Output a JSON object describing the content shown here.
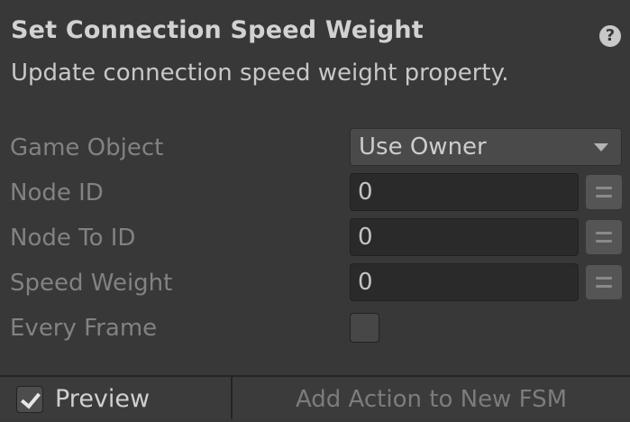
{
  "header": {
    "title": "Set Connection Speed Weight",
    "help_icon": "question-mark-icon",
    "help_glyph": "?",
    "description": "Update connection speed weight property."
  },
  "fields": {
    "game_object": {
      "label": "Game Object",
      "value": "Use Owner"
    },
    "node_id": {
      "label": "Node ID",
      "value": "0"
    },
    "node_to_id": {
      "label": "Node To ID",
      "value": "0"
    },
    "speed_weight": {
      "label": "Speed Weight",
      "value": "0"
    },
    "every_frame": {
      "label": "Every Frame",
      "checked": false
    }
  },
  "footer": {
    "preview_label": "Preview",
    "preview_checked": true,
    "add_action_label": "Add Action to New FSM"
  },
  "colors": {
    "background": "#383838",
    "field_background": "#2a2a2a",
    "label_text": "#828282",
    "value_text": "#c4c4c4"
  }
}
